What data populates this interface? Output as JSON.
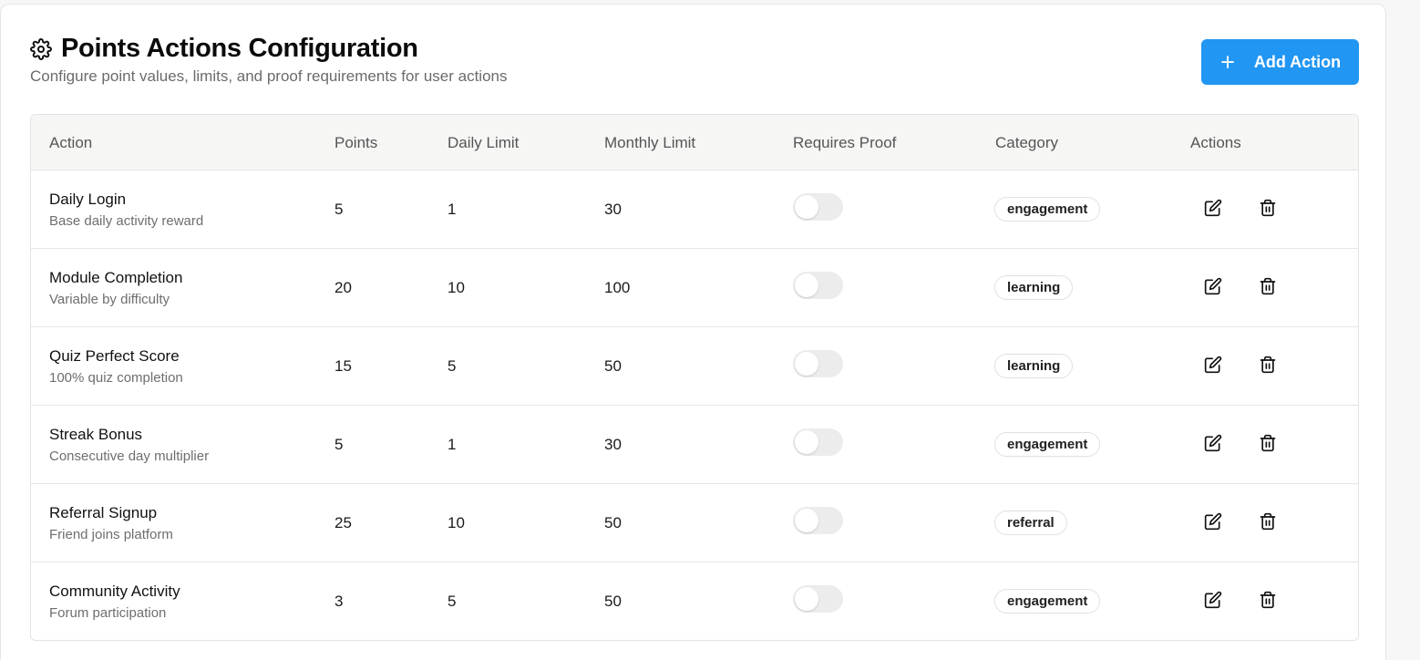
{
  "header": {
    "title": "Points Actions Configuration",
    "subtitle": "Configure point values, limits, and proof requirements for user actions",
    "title_icon": "gear-icon",
    "add_button_label": "Add Action",
    "add_button_icon": "plus-icon"
  },
  "colors": {
    "accent": "#2196f3",
    "toggle_off": "#ececec"
  },
  "table": {
    "columns": {
      "action": "Action",
      "points": "Points",
      "daily_limit": "Daily Limit",
      "monthly_limit": "Monthly Limit",
      "requires_proof": "Requires Proof",
      "category": "Category",
      "actions": "Actions"
    },
    "rows": [
      {
        "name": "Daily Login",
        "description": "Base daily activity reward",
        "points": "5",
        "daily_limit": "1",
        "monthly_limit": "30",
        "requires_proof": false,
        "category": "engagement"
      },
      {
        "name": "Module Completion",
        "description": "Variable by difficulty",
        "points": "20",
        "daily_limit": "10",
        "monthly_limit": "100",
        "requires_proof": false,
        "category": "learning"
      },
      {
        "name": "Quiz Perfect Score",
        "description": "100% quiz completion",
        "points": "15",
        "daily_limit": "5",
        "monthly_limit": "50",
        "requires_proof": false,
        "category": "learning"
      },
      {
        "name": "Streak Bonus",
        "description": "Consecutive day multiplier",
        "points": "5",
        "daily_limit": "1",
        "monthly_limit": "30",
        "requires_proof": false,
        "category": "engagement"
      },
      {
        "name": "Referral Signup",
        "description": "Friend joins platform",
        "points": "25",
        "daily_limit": "10",
        "monthly_limit": "50",
        "requires_proof": false,
        "category": "referral"
      },
      {
        "name": "Community Activity",
        "description": "Forum participation",
        "points": "3",
        "daily_limit": "5",
        "monthly_limit": "50",
        "requires_proof": false,
        "category": "engagement"
      }
    ],
    "row_icons": [
      "edit-icon",
      "trash-icon"
    ]
  }
}
